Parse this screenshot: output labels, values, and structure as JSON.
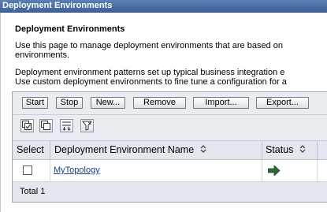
{
  "window": {
    "title": "Deployment Environments"
  },
  "page": {
    "heading": "Deployment Environments",
    "description_1_line1": "Use this page to manage deployment environments that are based on",
    "description_1_line2": "environments.",
    "description_2_line1": "Deployment environment patterns set up typical business integration e",
    "description_2_line2": "Use custom deployment environments to fine tune a configuration for a"
  },
  "toolbar": {
    "start_label": "Start",
    "stop_label": "Stop",
    "new_label": "New...",
    "remove_label": "Remove",
    "import_label": "Import...",
    "export_label": "Export..."
  },
  "icon_toolbar": {
    "icons": [
      "select-all-icon",
      "deselect-all-icon",
      "show-filter-icon",
      "clear-filter-icon"
    ]
  },
  "table": {
    "columns": [
      "Select",
      "Deployment Environment Name",
      "Status"
    ],
    "rows": [
      {
        "selected": false,
        "name": "MyTopology",
        "status_icon": "started-arrow-icon"
      }
    ],
    "total_label": "Total 1"
  },
  "colors": {
    "title_bar": "#3d6399",
    "link": "#1b3f8b",
    "panel_bg": "#e9edf2",
    "status_arrow": "#2d6a34"
  }
}
